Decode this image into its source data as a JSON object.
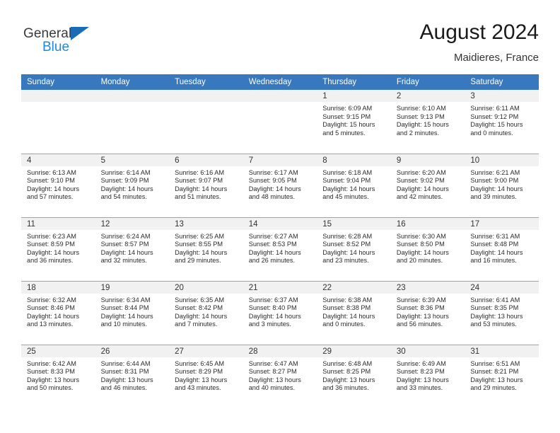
{
  "brand": {
    "line1": "General",
    "line2": "Blue",
    "triangle_icon": "brand-triangle-icon",
    "color_dark": "#3a3a3a",
    "color_blue": "#2288dd",
    "triangle_color": "#1a6cb5"
  },
  "header": {
    "title": "August 2024",
    "location": "Maidieres, France"
  },
  "theme": {
    "header_bg": "#3778be",
    "header_text": "#ffffff",
    "daynum_bg": "#f1f1f1",
    "row_divider": "#9aa3ab",
    "body_text": "#2b2b2b"
  },
  "calendar": {
    "weekday_headers": [
      "Sunday",
      "Monday",
      "Tuesday",
      "Wednesday",
      "Thursday",
      "Friday",
      "Saturday"
    ],
    "weeks": [
      [
        {
          "day": "",
          "empty": true
        },
        {
          "day": "",
          "empty": true
        },
        {
          "day": "",
          "empty": true
        },
        {
          "day": "",
          "empty": true
        },
        {
          "day": "1",
          "sunrise": "Sunrise: 6:09 AM",
          "sunset": "Sunset: 9:15 PM",
          "daylight": "Daylight: 15 hours and 5 minutes."
        },
        {
          "day": "2",
          "sunrise": "Sunrise: 6:10 AM",
          "sunset": "Sunset: 9:13 PM",
          "daylight": "Daylight: 15 hours and 2 minutes."
        },
        {
          "day": "3",
          "sunrise": "Sunrise: 6:11 AM",
          "sunset": "Sunset: 9:12 PM",
          "daylight": "Daylight: 15 hours and 0 minutes."
        }
      ],
      [
        {
          "day": "4",
          "sunrise": "Sunrise: 6:13 AM",
          "sunset": "Sunset: 9:10 PM",
          "daylight": "Daylight: 14 hours and 57 minutes."
        },
        {
          "day": "5",
          "sunrise": "Sunrise: 6:14 AM",
          "sunset": "Sunset: 9:09 PM",
          "daylight": "Daylight: 14 hours and 54 minutes."
        },
        {
          "day": "6",
          "sunrise": "Sunrise: 6:16 AM",
          "sunset": "Sunset: 9:07 PM",
          "daylight": "Daylight: 14 hours and 51 minutes."
        },
        {
          "day": "7",
          "sunrise": "Sunrise: 6:17 AM",
          "sunset": "Sunset: 9:05 PM",
          "daylight": "Daylight: 14 hours and 48 minutes."
        },
        {
          "day": "8",
          "sunrise": "Sunrise: 6:18 AM",
          "sunset": "Sunset: 9:04 PM",
          "daylight": "Daylight: 14 hours and 45 minutes."
        },
        {
          "day": "9",
          "sunrise": "Sunrise: 6:20 AM",
          "sunset": "Sunset: 9:02 PM",
          "daylight": "Daylight: 14 hours and 42 minutes."
        },
        {
          "day": "10",
          "sunrise": "Sunrise: 6:21 AM",
          "sunset": "Sunset: 9:00 PM",
          "daylight": "Daylight: 14 hours and 39 minutes."
        }
      ],
      [
        {
          "day": "11",
          "sunrise": "Sunrise: 6:23 AM",
          "sunset": "Sunset: 8:59 PM",
          "daylight": "Daylight: 14 hours and 36 minutes."
        },
        {
          "day": "12",
          "sunrise": "Sunrise: 6:24 AM",
          "sunset": "Sunset: 8:57 PM",
          "daylight": "Daylight: 14 hours and 32 minutes."
        },
        {
          "day": "13",
          "sunrise": "Sunrise: 6:25 AM",
          "sunset": "Sunset: 8:55 PM",
          "daylight": "Daylight: 14 hours and 29 minutes."
        },
        {
          "day": "14",
          "sunrise": "Sunrise: 6:27 AM",
          "sunset": "Sunset: 8:53 PM",
          "daylight": "Daylight: 14 hours and 26 minutes."
        },
        {
          "day": "15",
          "sunrise": "Sunrise: 6:28 AM",
          "sunset": "Sunset: 8:52 PM",
          "daylight": "Daylight: 14 hours and 23 minutes."
        },
        {
          "day": "16",
          "sunrise": "Sunrise: 6:30 AM",
          "sunset": "Sunset: 8:50 PM",
          "daylight": "Daylight: 14 hours and 20 minutes."
        },
        {
          "day": "17",
          "sunrise": "Sunrise: 6:31 AM",
          "sunset": "Sunset: 8:48 PM",
          "daylight": "Daylight: 14 hours and 16 minutes."
        }
      ],
      [
        {
          "day": "18",
          "sunrise": "Sunrise: 6:32 AM",
          "sunset": "Sunset: 8:46 PM",
          "daylight": "Daylight: 14 hours and 13 minutes."
        },
        {
          "day": "19",
          "sunrise": "Sunrise: 6:34 AM",
          "sunset": "Sunset: 8:44 PM",
          "daylight": "Daylight: 14 hours and 10 minutes."
        },
        {
          "day": "20",
          "sunrise": "Sunrise: 6:35 AM",
          "sunset": "Sunset: 8:42 PM",
          "daylight": "Daylight: 14 hours and 7 minutes."
        },
        {
          "day": "21",
          "sunrise": "Sunrise: 6:37 AM",
          "sunset": "Sunset: 8:40 PM",
          "daylight": "Daylight: 14 hours and 3 minutes."
        },
        {
          "day": "22",
          "sunrise": "Sunrise: 6:38 AM",
          "sunset": "Sunset: 8:38 PM",
          "daylight": "Daylight: 14 hours and 0 minutes."
        },
        {
          "day": "23",
          "sunrise": "Sunrise: 6:39 AM",
          "sunset": "Sunset: 8:36 PM",
          "daylight": "Daylight: 13 hours and 56 minutes."
        },
        {
          "day": "24",
          "sunrise": "Sunrise: 6:41 AM",
          "sunset": "Sunset: 8:35 PM",
          "daylight": "Daylight: 13 hours and 53 minutes."
        }
      ],
      [
        {
          "day": "25",
          "sunrise": "Sunrise: 6:42 AM",
          "sunset": "Sunset: 8:33 PM",
          "daylight": "Daylight: 13 hours and 50 minutes."
        },
        {
          "day": "26",
          "sunrise": "Sunrise: 6:44 AM",
          "sunset": "Sunset: 8:31 PM",
          "daylight": "Daylight: 13 hours and 46 minutes."
        },
        {
          "day": "27",
          "sunrise": "Sunrise: 6:45 AM",
          "sunset": "Sunset: 8:29 PM",
          "daylight": "Daylight: 13 hours and 43 minutes."
        },
        {
          "day": "28",
          "sunrise": "Sunrise: 6:47 AM",
          "sunset": "Sunset: 8:27 PM",
          "daylight": "Daylight: 13 hours and 40 minutes."
        },
        {
          "day": "29",
          "sunrise": "Sunrise: 6:48 AM",
          "sunset": "Sunset: 8:25 PM",
          "daylight": "Daylight: 13 hours and 36 minutes."
        },
        {
          "day": "30",
          "sunrise": "Sunrise: 6:49 AM",
          "sunset": "Sunset: 8:23 PM",
          "daylight": "Daylight: 13 hours and 33 minutes."
        },
        {
          "day": "31",
          "sunrise": "Sunrise: 6:51 AM",
          "sunset": "Sunset: 8:21 PM",
          "daylight": "Daylight: 13 hours and 29 minutes."
        }
      ]
    ]
  }
}
